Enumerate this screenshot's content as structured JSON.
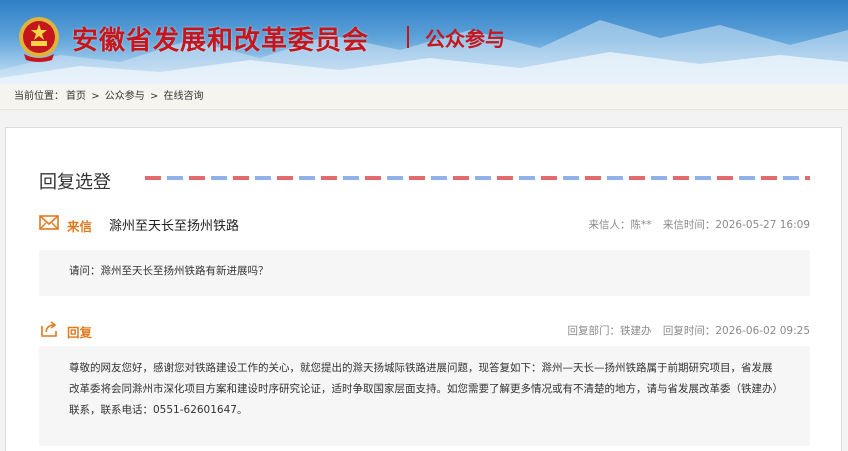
{
  "header": {
    "site_title": "安徽省发展和改革委员会",
    "section": "公众参与"
  },
  "breadcrumb": {
    "prefix": "当前位置：",
    "items": [
      "首页",
      "公众参与",
      "在线咨询"
    ],
    "separator": ">"
  },
  "panel": {
    "title": "回复选登"
  },
  "letter": {
    "tag": "来信",
    "subject": "滁州至天长至扬州铁路",
    "sender_label": "来信人：",
    "sender": "陈**",
    "time_label": "来信时间：",
    "time": "2026-05-27 16:09",
    "content": "请问：滁州至天长至扬州铁路有新进展吗？"
  },
  "reply": {
    "tag": "回复",
    "dept_label": "回复部门：",
    "dept": "铁建办",
    "time_label": "回复时间：",
    "time": "2026-06-02 09:25",
    "content": "尊敬的网友您好，感谢您对铁路建设工作的关心，就您提出的滁天扬城际铁路进展问题，现答复如下：滁州—天长—扬州铁路属于前期研究项目，省发展改革委将会同滁州市深化项目方案和建设时序研究论证，适时争取国家层面支持。如您需要了解更多情况或有不清楚的地方，请与省发展改革委（铁建办）联系，联系电话：0551-62601647。"
  },
  "colors": {
    "title_red": "#c4161c",
    "tag_orange": "#e07a1f",
    "meta_gray": "#8a8a8a"
  },
  "icons": {
    "emblem": "national-emblem-icon",
    "letter": "envelope-icon",
    "reply": "reply-share-icon"
  }
}
